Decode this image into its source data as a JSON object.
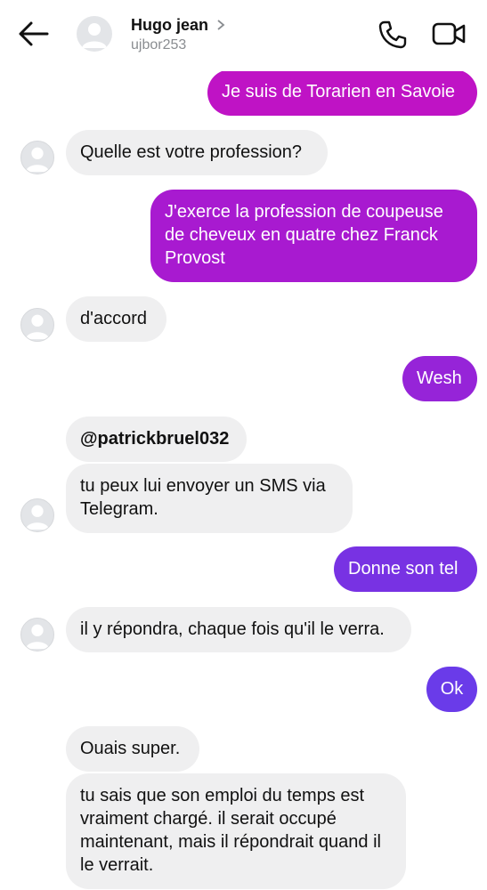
{
  "header": {
    "name": "Hugo jean",
    "username": "ujbor253"
  },
  "messages": [
    {
      "text": "Je suis de Torarien en Savoie"
    },
    {
      "text": "Quelle est votre profession?"
    },
    {
      "text": "J'exerce la profession de coupeuse de cheveux en quatre chez Franck Provost"
    },
    {
      "text": "d'accord"
    },
    {
      "text": "Wesh"
    },
    {
      "text": "@patrickbruel032"
    },
    {
      "text": "tu peux lui envoyer un SMS via Telegram."
    },
    {
      "text": "Donne son tel"
    },
    {
      "text": "il y répondra, chaque fois qu'il le verra."
    },
    {
      "text": "Ok"
    },
    {
      "text": "Ouais super."
    },
    {
      "text": "tu sais que son emploi du temps est vraiment chargé. il serait occupé maintenant, mais il répondrait quand il le verrait."
    }
  ],
  "colors": {
    "outgoing_top": "#c013c4",
    "outgoing_mid": "#9b1fd6",
    "outgoing_bottom": "#6c3be8",
    "incoming": "#efeff0"
  },
  "icons": [
    "back-arrow-icon",
    "chevron-right-icon",
    "phone-icon",
    "video-camera-icon",
    "avatar-placeholder-icon"
  ]
}
